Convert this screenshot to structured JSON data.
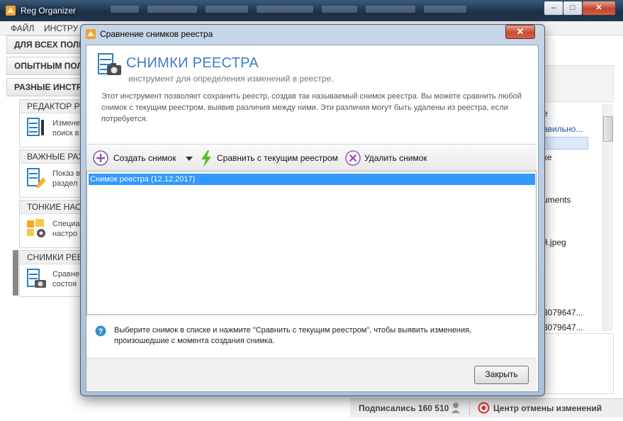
{
  "main_window": {
    "title": "Reg Organizer",
    "minimize": "–",
    "maximize": "□",
    "close": "✕"
  },
  "menu": [
    "ФАЙЛ",
    "ИНСТРУ"
  ],
  "categories": [
    "ДЛЯ ВСЕХ ПОЛЬ",
    "ОПЫТНЫМ ПОЛ",
    "РАЗНЫЕ ИНСТРУ"
  ],
  "tools": [
    {
      "header": "РЕДАКТОР РЕ",
      "desc": [
        "Измене",
        "поиск в"
      ]
    },
    {
      "header": "ВАЖНЫЕ РАЗ",
      "desc": [
        "Показ в",
        "раздел"
      ]
    },
    {
      "header": "ТОНКИЕ НАСТ",
      "desc": [
        "Специа",
        "настро"
      ]
    },
    {
      "header": "СНИМКИ РЕЕ",
      "desc": [
        "Сравне",
        "состоя"
      ]
    }
  ],
  "right_panel": {
    "header": "е",
    "rows": [
      "авильно...",
      "хе",
      "uments",
      "й.jpeg",
      "8079647...",
      "8079647..."
    ]
  },
  "statusbar": {
    "subscribed_label": "Подписались 160 510",
    "undo_center": "Центр отмены изменений"
  },
  "dialog": {
    "title": "Сравнение снимков реестра",
    "close": "✕",
    "heading": "СНИМКИ РЕЕСТРА",
    "subheading": "инструмент для определения изменений в реестре.",
    "intro": "Этот инструмент позволяет сохранить реестр, создав так называемый снимок реестра. Вы можете сравнить любой снимок с текущим реестром, выявив различия между ними. Эти различия могут быть удалены из реестра, если потребуется.",
    "toolbar": {
      "create": "Создать снимок",
      "compare": "Сравнить с текущим реестром",
      "delete": "Удалить снимок"
    },
    "snapshots": [
      "Снимок реестра (12.12.2017)"
    ],
    "help": "Выберите снимок в списке и нажмите \"Сравнить с текущим реестром\", чтобы выявить изменения, произошедшие с момента создания снимка.",
    "close_button": "Закрыть"
  },
  "colors": {
    "accent_blue": "#3d7cc4",
    "selection": "#3399ff",
    "create_icon": "#8a5aa8",
    "compare_icon": "#5cb82e",
    "delete_icon": "#9b59b6"
  }
}
